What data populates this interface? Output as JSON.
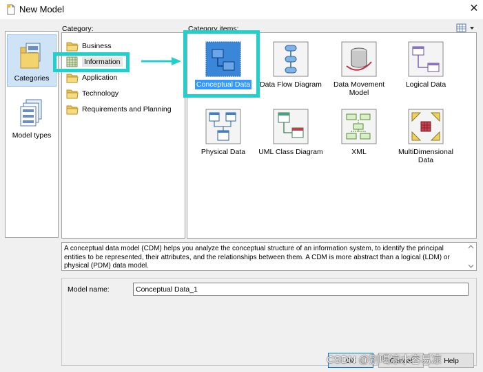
{
  "window": {
    "title": "New Model",
    "close_glyph": "✕"
  },
  "nav": {
    "items": [
      {
        "label": "Categories",
        "icon": "categories-icon",
        "selected": true
      },
      {
        "label": "Model types",
        "icon": "model-types-icon",
        "selected": false
      }
    ]
  },
  "category": {
    "label": "Category:",
    "items": [
      {
        "label": "Business",
        "icon": "folder-icon"
      },
      {
        "label": "Information",
        "icon": "information-grid-icon",
        "selected": true
      },
      {
        "label": "Application",
        "icon": "folder-icon"
      },
      {
        "label": "Technology",
        "icon": "folder-icon"
      },
      {
        "label": "Requirements and Planning",
        "icon": "folder-icon"
      }
    ]
  },
  "category_items": {
    "label": "Category items:",
    "tiles": [
      {
        "label": "Conceptual Data",
        "icon": "conceptual-data-icon",
        "selected": true
      },
      {
        "label": "Data Flow Diagram",
        "icon": "data-flow-diagram-icon"
      },
      {
        "label": "Data Movement\nModel",
        "icon": "data-movement-model-icon"
      },
      {
        "label": "Logical Data",
        "icon": "logical-data-icon"
      },
      {
        "label": "Physical Data",
        "icon": "physical-data-icon"
      },
      {
        "label": "UML Class Diagram",
        "icon": "uml-class-diagram-icon"
      },
      {
        "label": "XML",
        "icon": "xml-icon"
      },
      {
        "label": "MultiDimensional\nData",
        "icon": "multidimensional-data-icon"
      }
    ]
  },
  "description": "A conceptual data model (CDM) helps you analyze the conceptual structure of an information system, to identify the principal entities to be represented, their attributes, and the relationships between them. A CDM is more abstract than a logical (LDM) or physical (PDM) data model.",
  "model_name": {
    "label": "Model name:",
    "value": "Conceptual Data_1"
  },
  "buttons": {
    "ok": "OK",
    "cancel": "Cancel",
    "help": "Help"
  },
  "watermark": "CSDN @别喝凉水容易凉",
  "colors": {
    "highlight": "#20d0cc",
    "selection": "#3399ff"
  }
}
